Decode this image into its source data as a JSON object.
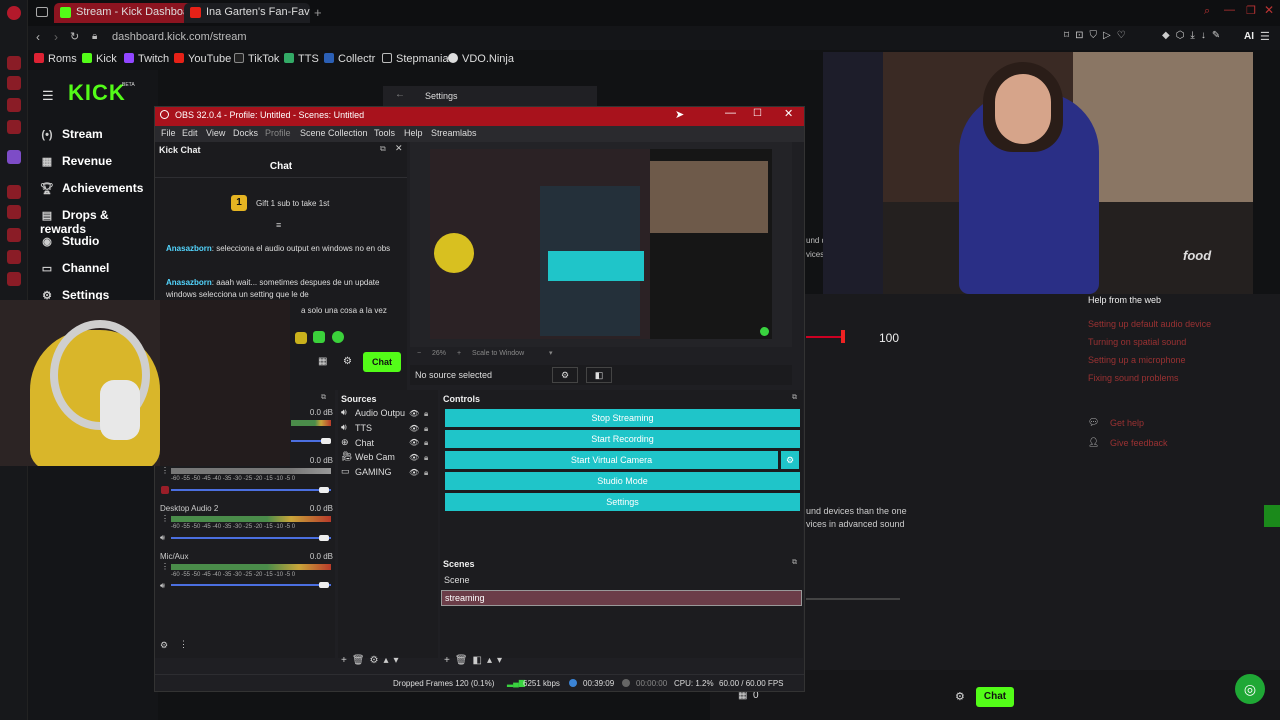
{
  "browser": {
    "tabs": [
      {
        "label": "Stream - Kick Dashboard",
        "active": true
      },
      {
        "label": "Ina Garten's Fan-Favor",
        "active": false
      }
    ],
    "url": "dashboard.kick.com/stream",
    "bookmarks": [
      "Roms",
      "Kick",
      "Twitch",
      "YouTube",
      "TikTok",
      "TTS",
      "Collectr",
      "Stepmania",
      "VDO.Ninja"
    ],
    "toolbar_right": "AI"
  },
  "kick": {
    "logo": "KICK",
    "logo_beta": "BETA",
    "nav": [
      "Stream",
      "Revenue",
      "Achievements",
      "Drops & rewards",
      "Studio",
      "Channel",
      "Settings"
    ],
    "settings_tab": "Settings",
    "chat_button": "Chat",
    "volume_value": "100",
    "help_title": "Help from the web",
    "help_links": [
      "Setting up default audio device",
      "Turning on spatial sound",
      "Setting up a microphone",
      "Fixing sound problems"
    ],
    "get_help": "Get help",
    "give_feedback": "Give feedback",
    "sound_note": "und devices than the one\nvices in advanced sound",
    "settings_panel_hint_1": "und d",
    "settings_panel_hint_2": "vices",
    "bottom_count": "0",
    "accent": "#53fc18"
  },
  "obs": {
    "title": "OBS 32.0.4 - Profile: Untitled - Scenes: Untitled",
    "menu": [
      "File",
      "Edit",
      "View",
      "Docks",
      "Profile",
      "Scene Collection",
      "Tools",
      "Help",
      "Streamlabs"
    ],
    "kick_chat_dock": "Kick Chat",
    "chat_header": "Chat",
    "gift_text": "Gift 1 sub to take 1st",
    "gift_rank": "1",
    "messages": [
      {
        "user": "Anasazborn",
        "text": ": selecciona el audio output en windows no en obs"
      },
      {
        "user": "Anasazborn",
        "text": ": aaah wait... sometimes despues de un update windows selecciona un setting que le de"
      },
      {
        "user": "",
        "text": "a solo una cosa a la vez"
      }
    ],
    "chat_send": "Chat",
    "zoom": "26%",
    "scale_mode": "Scale to Window",
    "no_source": "No source selected",
    "sources_title": "Sources",
    "sources": [
      "Audio Outpu",
      "TTS",
      "Chat",
      "Web Cam",
      "GAMING"
    ],
    "controls_title": "Controls",
    "controls": [
      "Stop Streaming",
      "Start Recording",
      "Start Virtual Camera",
      "Studio Mode",
      "Settings"
    ],
    "scenes_title": "Scenes",
    "scenes": [
      "Scene",
      "streaming"
    ],
    "mixer": [
      {
        "name": "",
        "db": "0.0 dB"
      },
      {
        "name": "",
        "db": "0.0 dB"
      },
      {
        "name": "Desktop Audio 2",
        "db": "0.0 dB"
      },
      {
        "name": "Mic/Aux",
        "db": "0.0 dB"
      }
    ],
    "meter_scale": "-60 -55 -50 -45 -40 -35 -30 -25 -20 -15 -10 -5 0",
    "status": {
      "dropped": "Dropped Frames 120 (0.1%)",
      "bitrate": "6251 kbps",
      "stream_time": "00:39:09",
      "rec_time": "00:00:00",
      "cpu": "CPU: 1.2%",
      "fps": "60.00 / 60.00 FPS"
    },
    "accent": "#1fc5c9",
    "title_color": "#a8121c"
  },
  "video": {
    "watermark": "food"
  }
}
